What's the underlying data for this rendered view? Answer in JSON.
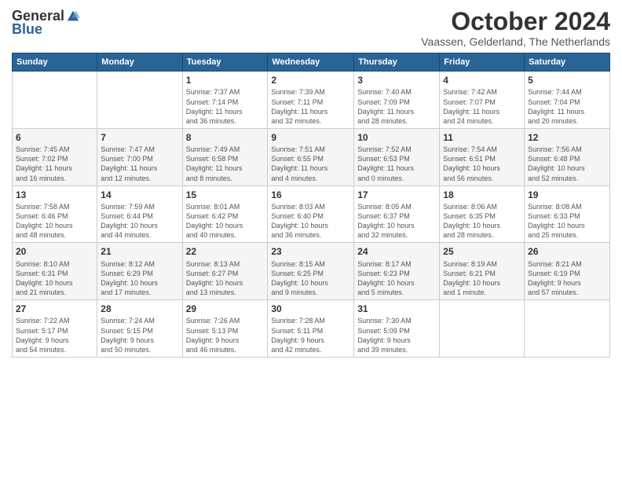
{
  "header": {
    "logo_general": "General",
    "logo_blue": "Blue",
    "month_title": "October 2024",
    "location": "Vaassen, Gelderland, The Netherlands"
  },
  "days_of_week": [
    "Sunday",
    "Monday",
    "Tuesday",
    "Wednesday",
    "Thursday",
    "Friday",
    "Saturday"
  ],
  "weeks": [
    [
      {
        "day": "",
        "info": ""
      },
      {
        "day": "",
        "info": ""
      },
      {
        "day": "1",
        "info": "Sunrise: 7:37 AM\nSunset: 7:14 PM\nDaylight: 11 hours\nand 36 minutes."
      },
      {
        "day": "2",
        "info": "Sunrise: 7:39 AM\nSunset: 7:11 PM\nDaylight: 11 hours\nand 32 minutes."
      },
      {
        "day": "3",
        "info": "Sunrise: 7:40 AM\nSunset: 7:09 PM\nDaylight: 11 hours\nand 28 minutes."
      },
      {
        "day": "4",
        "info": "Sunrise: 7:42 AM\nSunset: 7:07 PM\nDaylight: 11 hours\nand 24 minutes."
      },
      {
        "day": "5",
        "info": "Sunrise: 7:44 AM\nSunset: 7:04 PM\nDaylight: 11 hours\nand 20 minutes."
      }
    ],
    [
      {
        "day": "6",
        "info": "Sunrise: 7:45 AM\nSunset: 7:02 PM\nDaylight: 11 hours\nand 16 minutes."
      },
      {
        "day": "7",
        "info": "Sunrise: 7:47 AM\nSunset: 7:00 PM\nDaylight: 11 hours\nand 12 minutes."
      },
      {
        "day": "8",
        "info": "Sunrise: 7:49 AM\nSunset: 6:58 PM\nDaylight: 11 hours\nand 8 minutes."
      },
      {
        "day": "9",
        "info": "Sunrise: 7:51 AM\nSunset: 6:55 PM\nDaylight: 11 hours\nand 4 minutes."
      },
      {
        "day": "10",
        "info": "Sunrise: 7:52 AM\nSunset: 6:53 PM\nDaylight: 11 hours\nand 0 minutes."
      },
      {
        "day": "11",
        "info": "Sunrise: 7:54 AM\nSunset: 6:51 PM\nDaylight: 10 hours\nand 56 minutes."
      },
      {
        "day": "12",
        "info": "Sunrise: 7:56 AM\nSunset: 6:48 PM\nDaylight: 10 hours\nand 52 minutes."
      }
    ],
    [
      {
        "day": "13",
        "info": "Sunrise: 7:58 AM\nSunset: 6:46 PM\nDaylight: 10 hours\nand 48 minutes."
      },
      {
        "day": "14",
        "info": "Sunrise: 7:59 AM\nSunset: 6:44 PM\nDaylight: 10 hours\nand 44 minutes."
      },
      {
        "day": "15",
        "info": "Sunrise: 8:01 AM\nSunset: 6:42 PM\nDaylight: 10 hours\nand 40 minutes."
      },
      {
        "day": "16",
        "info": "Sunrise: 8:03 AM\nSunset: 6:40 PM\nDaylight: 10 hours\nand 36 minutes."
      },
      {
        "day": "17",
        "info": "Sunrise: 8:05 AM\nSunset: 6:37 PM\nDaylight: 10 hours\nand 32 minutes."
      },
      {
        "day": "18",
        "info": "Sunrise: 8:06 AM\nSunset: 6:35 PM\nDaylight: 10 hours\nand 28 minutes."
      },
      {
        "day": "19",
        "info": "Sunrise: 8:08 AM\nSunset: 6:33 PM\nDaylight: 10 hours\nand 25 minutes."
      }
    ],
    [
      {
        "day": "20",
        "info": "Sunrise: 8:10 AM\nSunset: 6:31 PM\nDaylight: 10 hours\nand 21 minutes."
      },
      {
        "day": "21",
        "info": "Sunrise: 8:12 AM\nSunset: 6:29 PM\nDaylight: 10 hours\nand 17 minutes."
      },
      {
        "day": "22",
        "info": "Sunrise: 8:13 AM\nSunset: 6:27 PM\nDaylight: 10 hours\nand 13 minutes."
      },
      {
        "day": "23",
        "info": "Sunrise: 8:15 AM\nSunset: 6:25 PM\nDaylight: 10 hours\nand 9 minutes."
      },
      {
        "day": "24",
        "info": "Sunrise: 8:17 AM\nSunset: 6:23 PM\nDaylight: 10 hours\nand 5 minutes."
      },
      {
        "day": "25",
        "info": "Sunrise: 8:19 AM\nSunset: 6:21 PM\nDaylight: 10 hours\nand 1 minute."
      },
      {
        "day": "26",
        "info": "Sunrise: 8:21 AM\nSunset: 6:19 PM\nDaylight: 9 hours\nand 57 minutes."
      }
    ],
    [
      {
        "day": "27",
        "info": "Sunrise: 7:22 AM\nSunset: 5:17 PM\nDaylight: 9 hours\nand 54 minutes."
      },
      {
        "day": "28",
        "info": "Sunrise: 7:24 AM\nSunset: 5:15 PM\nDaylight: 9 hours\nand 50 minutes."
      },
      {
        "day": "29",
        "info": "Sunrise: 7:26 AM\nSunset: 5:13 PM\nDaylight: 9 hours\nand 46 minutes."
      },
      {
        "day": "30",
        "info": "Sunrise: 7:28 AM\nSunset: 5:11 PM\nDaylight: 9 hours\nand 42 minutes."
      },
      {
        "day": "31",
        "info": "Sunrise: 7:30 AM\nSunset: 5:09 PM\nDaylight: 9 hours\nand 39 minutes."
      },
      {
        "day": "",
        "info": ""
      },
      {
        "day": "",
        "info": ""
      }
    ]
  ]
}
